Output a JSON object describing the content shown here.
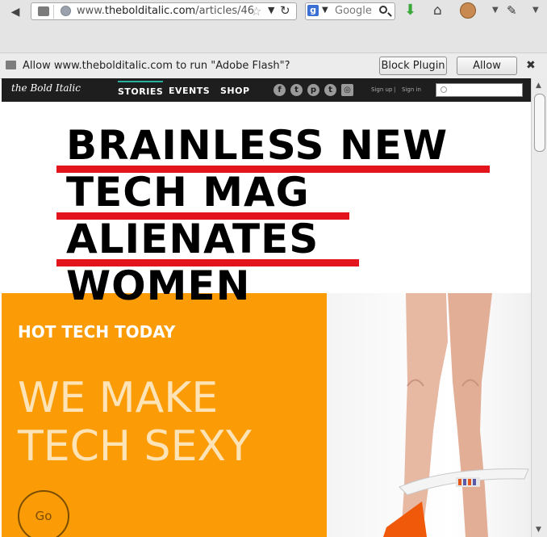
{
  "browser": {
    "url_prefix": "www.",
    "url_domain": "thebolditalic.com",
    "url_path": "/articles/46",
    "search_engine_letter": "g",
    "search_placeholder": "Google"
  },
  "plugin_bar": {
    "message": "Allow www.thebolditalic.com to run \"Adobe Flash\"?",
    "block_label": "Block Plugin",
    "allow_label": "Allow"
  },
  "site_nav": {
    "logo": "the Bold Italic",
    "links": [
      "STORIES",
      "EVENTS",
      "SHOP"
    ],
    "social": [
      "f",
      "t",
      "p",
      "t",
      "◎"
    ],
    "sign_up": "Sign up",
    "divider": "|",
    "sign_in": "Sign in"
  },
  "headline": {
    "lines": [
      "BRAINLESS NEW",
      "TECH MAG",
      "ALIENATES",
      "WOMEN"
    ]
  },
  "hero": {
    "kicker": "HOT TECH TODAY",
    "line1": "WE MAKE",
    "line2": "TECH SEXY",
    "go_label": "Go"
  },
  "colors": {
    "accent_red": "#e3141c",
    "hero_orange": "#fb9c07",
    "nav_dark": "#1e1e1e",
    "nav_active": "#2bb0a0"
  }
}
